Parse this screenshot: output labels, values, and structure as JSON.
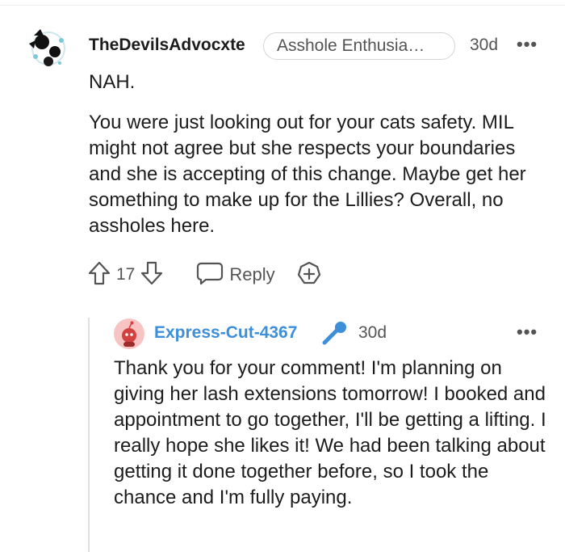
{
  "parent_comment": {
    "username": "TheDevilsAdvocxte",
    "flair": "Asshole Enthusia…",
    "time": "30d",
    "more_icon": "more-options-icon",
    "body_first_line": "NAH.",
    "body_paragraph": "You were just looking out for your cats safety. MIL might not agree but she respects your boundaries and she is accepting of this change. Maybe get her something to make up for the Lillies? Overall, no assholes here.",
    "vote_count": "17",
    "reply_label": "Reply"
  },
  "reply_comment": {
    "username": "Express-Cut-4367",
    "user_color": "#3d8fd9",
    "time": "30d",
    "badge_icon": "microphone-icon",
    "body": "Thank you for your comment! I'm planning on giving her lash extensions tomorrow! I booked and appointment to go together, I'll be getting a lifting. I really hope she likes it! We had been talking about getting it done together before, so I took the chance and I'm fully paying."
  },
  "colors": {
    "text": "#1c1c1c",
    "meta": "#545454",
    "link_blue": "#3d8fd9",
    "avatar_pink": "#f7c3c3"
  }
}
